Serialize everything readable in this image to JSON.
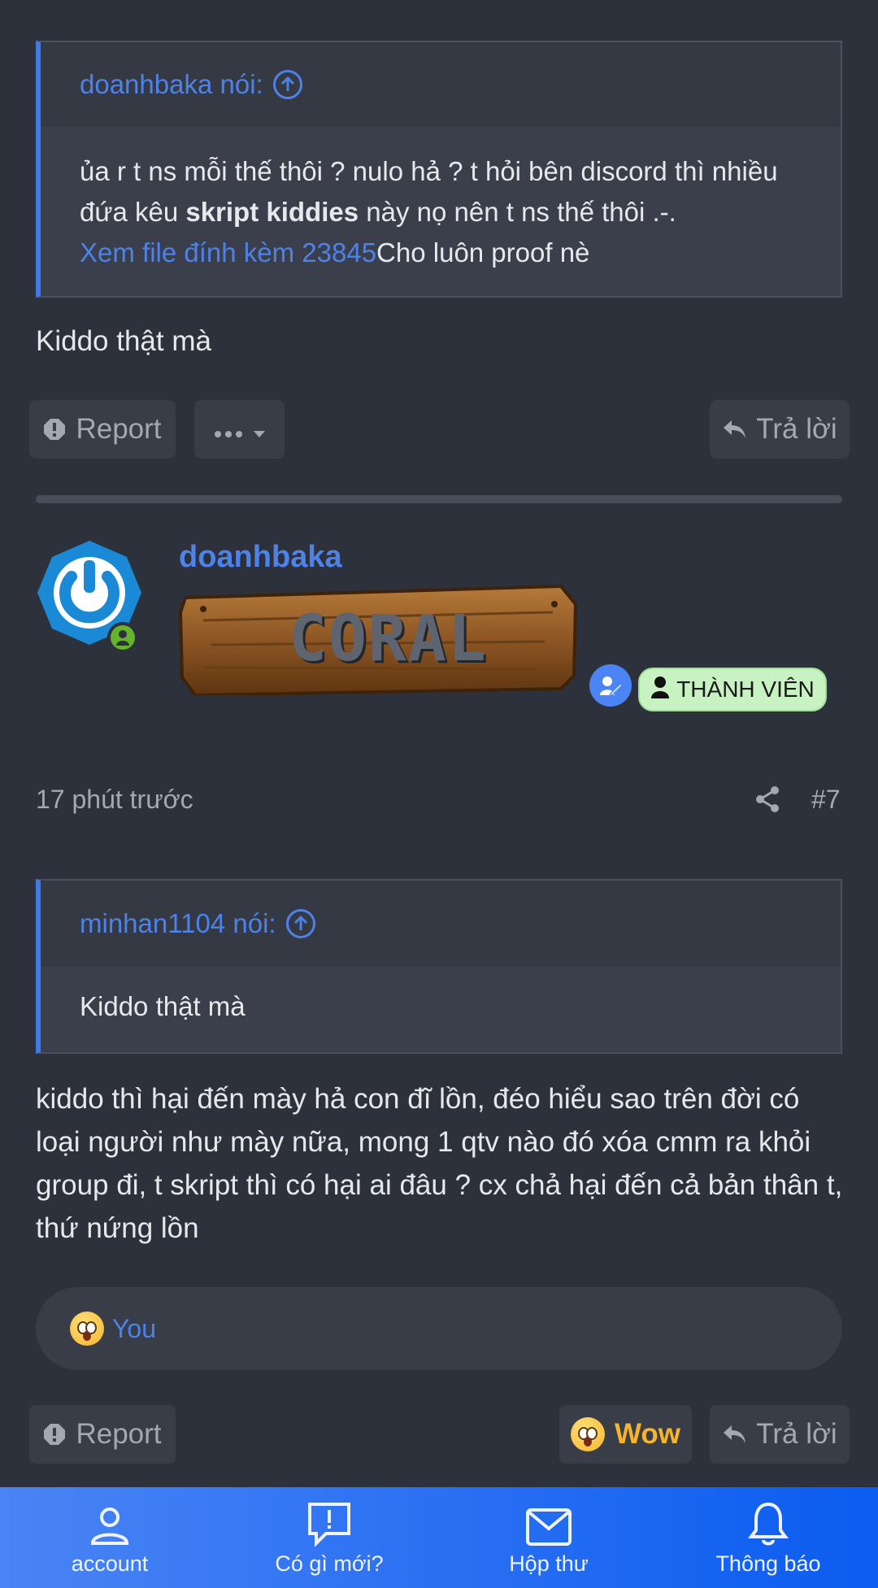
{
  "quote1": {
    "author": "doanhbaka nói:",
    "body_part1": "ủa r t ns mỗi thế thôi ? nulo hả ? t hỏi bên discord thì nhiều đứa kêu ",
    "body_bold": "skript kiddies",
    "body_part2": " này nọ nên t ns thế thôi .-.",
    "attachment_link": "Xem file đính kèm 23845",
    "attachment_after": "Cho luôn proof nè"
  },
  "post1": {
    "text": "Kiddo thật mà",
    "report_label": "Report",
    "reply_label": "Trả lời"
  },
  "post2": {
    "username": "doanhbaka",
    "banner_text": "CORAL",
    "role_badge": "THÀNH VIÊN",
    "time": "17 phút trước",
    "post_number": "#7",
    "quote": {
      "author": "minhan1104 nói:",
      "body": "Kiddo thật mà"
    },
    "text": "kiddo thì hại đến mày hả con đĩ lồn, đéo hiểu sao trên đời có loại người như mày nữa, mong 1 qtv nào đó xóa cmm ra khỏi group đi, t skript thì có hại ai đâu ? cx chả hại đến cả bản thân t, thứ nứng lồn",
    "reactions_by": "You",
    "report_label": "Report",
    "reaction_label": "Wow",
    "reply_label": "Trả lời"
  },
  "bottom_nav": [
    {
      "label": "account",
      "icon": "account-icon"
    },
    {
      "label": "Có gì mới?",
      "icon": "whats-new-icon"
    },
    {
      "label": "Hộp thư",
      "icon": "mail-icon"
    },
    {
      "label": "Thông báo",
      "icon": "bell-icon"
    }
  ],
  "colors": {
    "background": "#2d313b",
    "accent": "#4d82e8",
    "nav_start": "#4a84f5",
    "nav_end": "#0b5cf0",
    "badge_bg": "#c9f2c3",
    "wow": "#f5b52b"
  }
}
